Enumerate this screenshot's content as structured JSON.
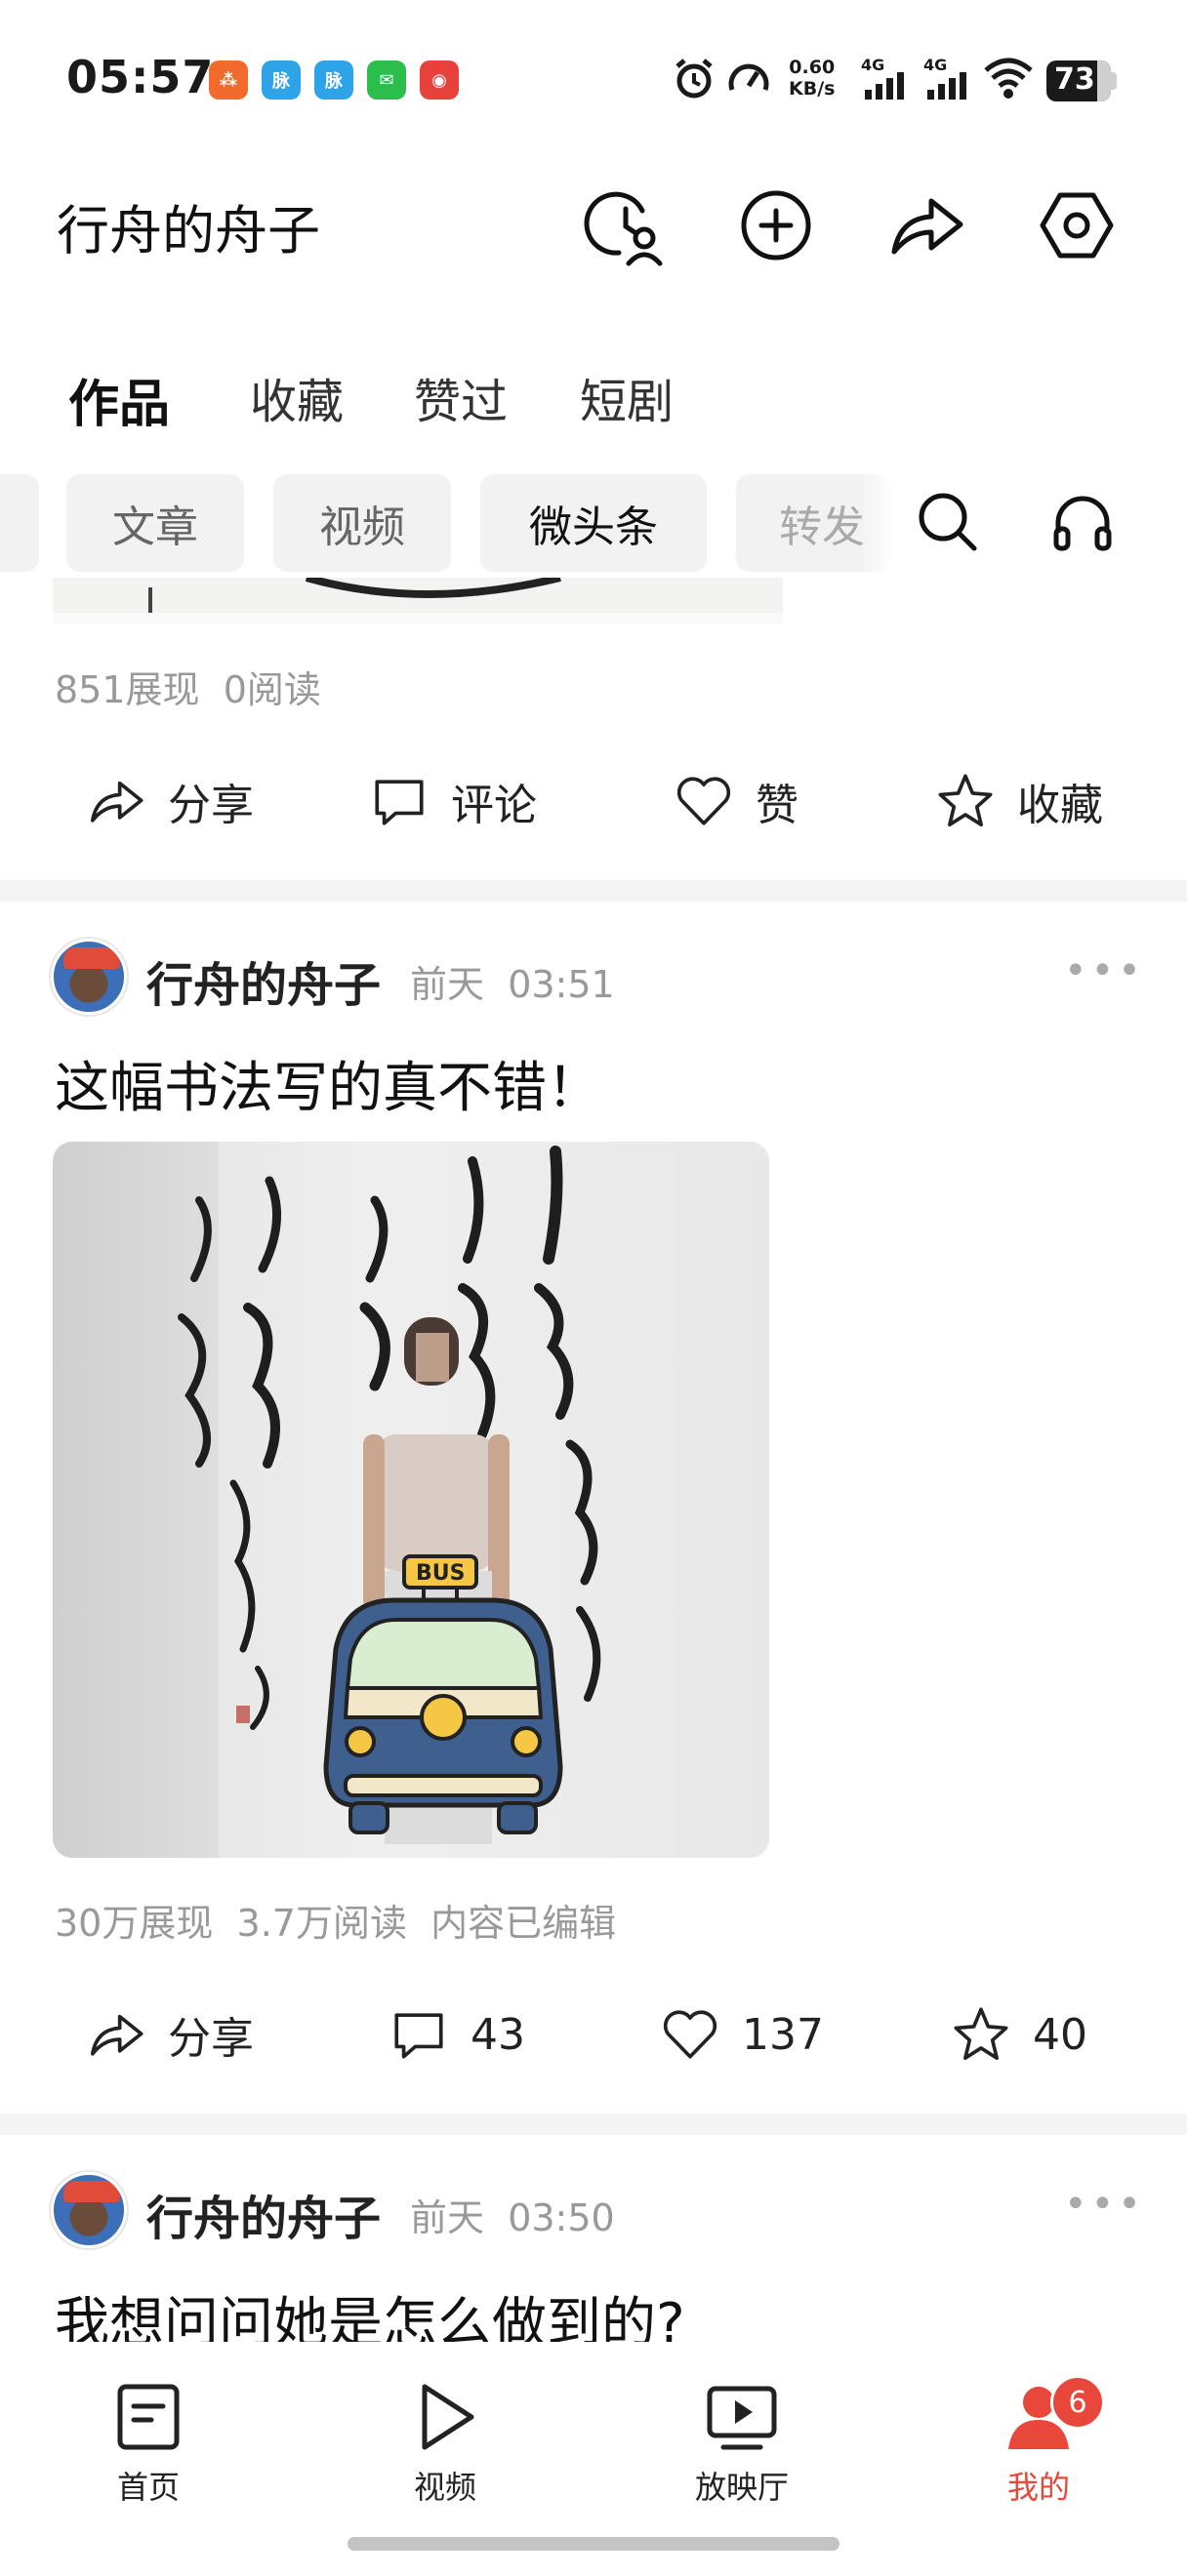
{
  "status_bar": {
    "time": "05:57",
    "apps": [
      {
        "name": "app-1",
        "color": "#f36b2c",
        "glyph": "⁂"
      },
      {
        "name": "app-2",
        "color": "#2fa3e8",
        "glyph": "脉"
      },
      {
        "name": "app-3",
        "color": "#2fa3e8",
        "glyph": "脉"
      },
      {
        "name": "wechat",
        "color": "#2cbe4d",
        "glyph": "✉"
      },
      {
        "name": "netease-music",
        "color": "#e8403b",
        "glyph": "◉"
      }
    ],
    "net_speed_value": "0.60",
    "net_speed_unit": "KB/s",
    "signal_1": "4G",
    "signal_2": "4G",
    "battery": "73"
  },
  "header": {
    "title": "行舟的舟子"
  },
  "main_tabs": [
    {
      "label": "作品",
      "active": true
    },
    {
      "label": "收藏",
      "active": false
    },
    {
      "label": "赞过",
      "active": false
    },
    {
      "label": "短剧",
      "active": false
    }
  ],
  "filter_chips": [
    {
      "label": "文章",
      "active": false
    },
    {
      "label": "视频",
      "active": false
    },
    {
      "label": "微头条",
      "active": true
    },
    {
      "label": "转发",
      "active": false
    }
  ],
  "post_prev": {
    "views": "851展现",
    "reads": "0阅读",
    "actions": {
      "share": "分享",
      "comment": "评论",
      "like": "赞",
      "favorite": "收藏"
    }
  },
  "post_1": {
    "author": "行舟的舟子",
    "day": "前天",
    "time": "03:51",
    "text": "这幅书法写的真不错！",
    "image_sign": "BUS",
    "views": "30万展现",
    "reads": "3.7万阅读",
    "edited": "内容已编辑",
    "actions": {
      "share": "分享",
      "comments": "43",
      "likes": "137",
      "favorites": "40"
    }
  },
  "post_2": {
    "author": "行舟的舟子",
    "day": "前天",
    "time": "03:50",
    "text": "我想问问她是怎么做到的?"
  },
  "bottom_nav": {
    "items": [
      {
        "label": "首页",
        "icon": "home-doc-icon"
      },
      {
        "label": "视频",
        "icon": "play-icon"
      },
      {
        "label": "放映厅",
        "icon": "tv-icon"
      },
      {
        "label": "我的",
        "icon": "person-icon",
        "active": true
      }
    ],
    "badge": "6"
  },
  "colors": {
    "accent": "#e8473b",
    "muted": "#999999",
    "chip_bg": "#f2f2f2"
  }
}
